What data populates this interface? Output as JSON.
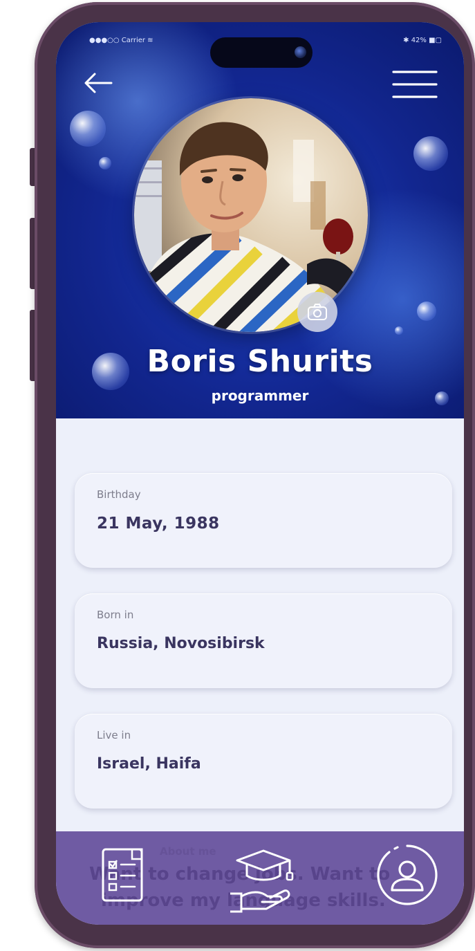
{
  "status_bar": {
    "carrier": "●●●○○ Carrier ≋",
    "battery": "✱ 42% ■▢"
  },
  "header": {
    "back_icon": "arrow-left-icon",
    "menu_icon": "hamburger-menu-icon"
  },
  "profile": {
    "name": "Boris Shurits",
    "role": "programmer",
    "avatar_icon": "profile-photo",
    "camera_icon": "camera-icon"
  },
  "details": [
    {
      "label": "Birthday",
      "value": "21 May, 1988"
    },
    {
      "label": "Born in",
      "value": "Russia, Novosibirsk"
    },
    {
      "label": "Live in",
      "value": "Israel, Haifa"
    }
  ],
  "obscured_text": {
    "line0": "About me",
    "line1": "Want to change jobs. Want to",
    "line2": "improve my language skills."
  },
  "bottom_nav": {
    "items": [
      "checklist-icon",
      "education-hand-icon",
      "user-profile-icon"
    ]
  },
  "colors": {
    "hero": "#12268f",
    "nav": "#6f5ba3",
    "text_dark": "#3a3560",
    "frame": "#4a3348"
  }
}
